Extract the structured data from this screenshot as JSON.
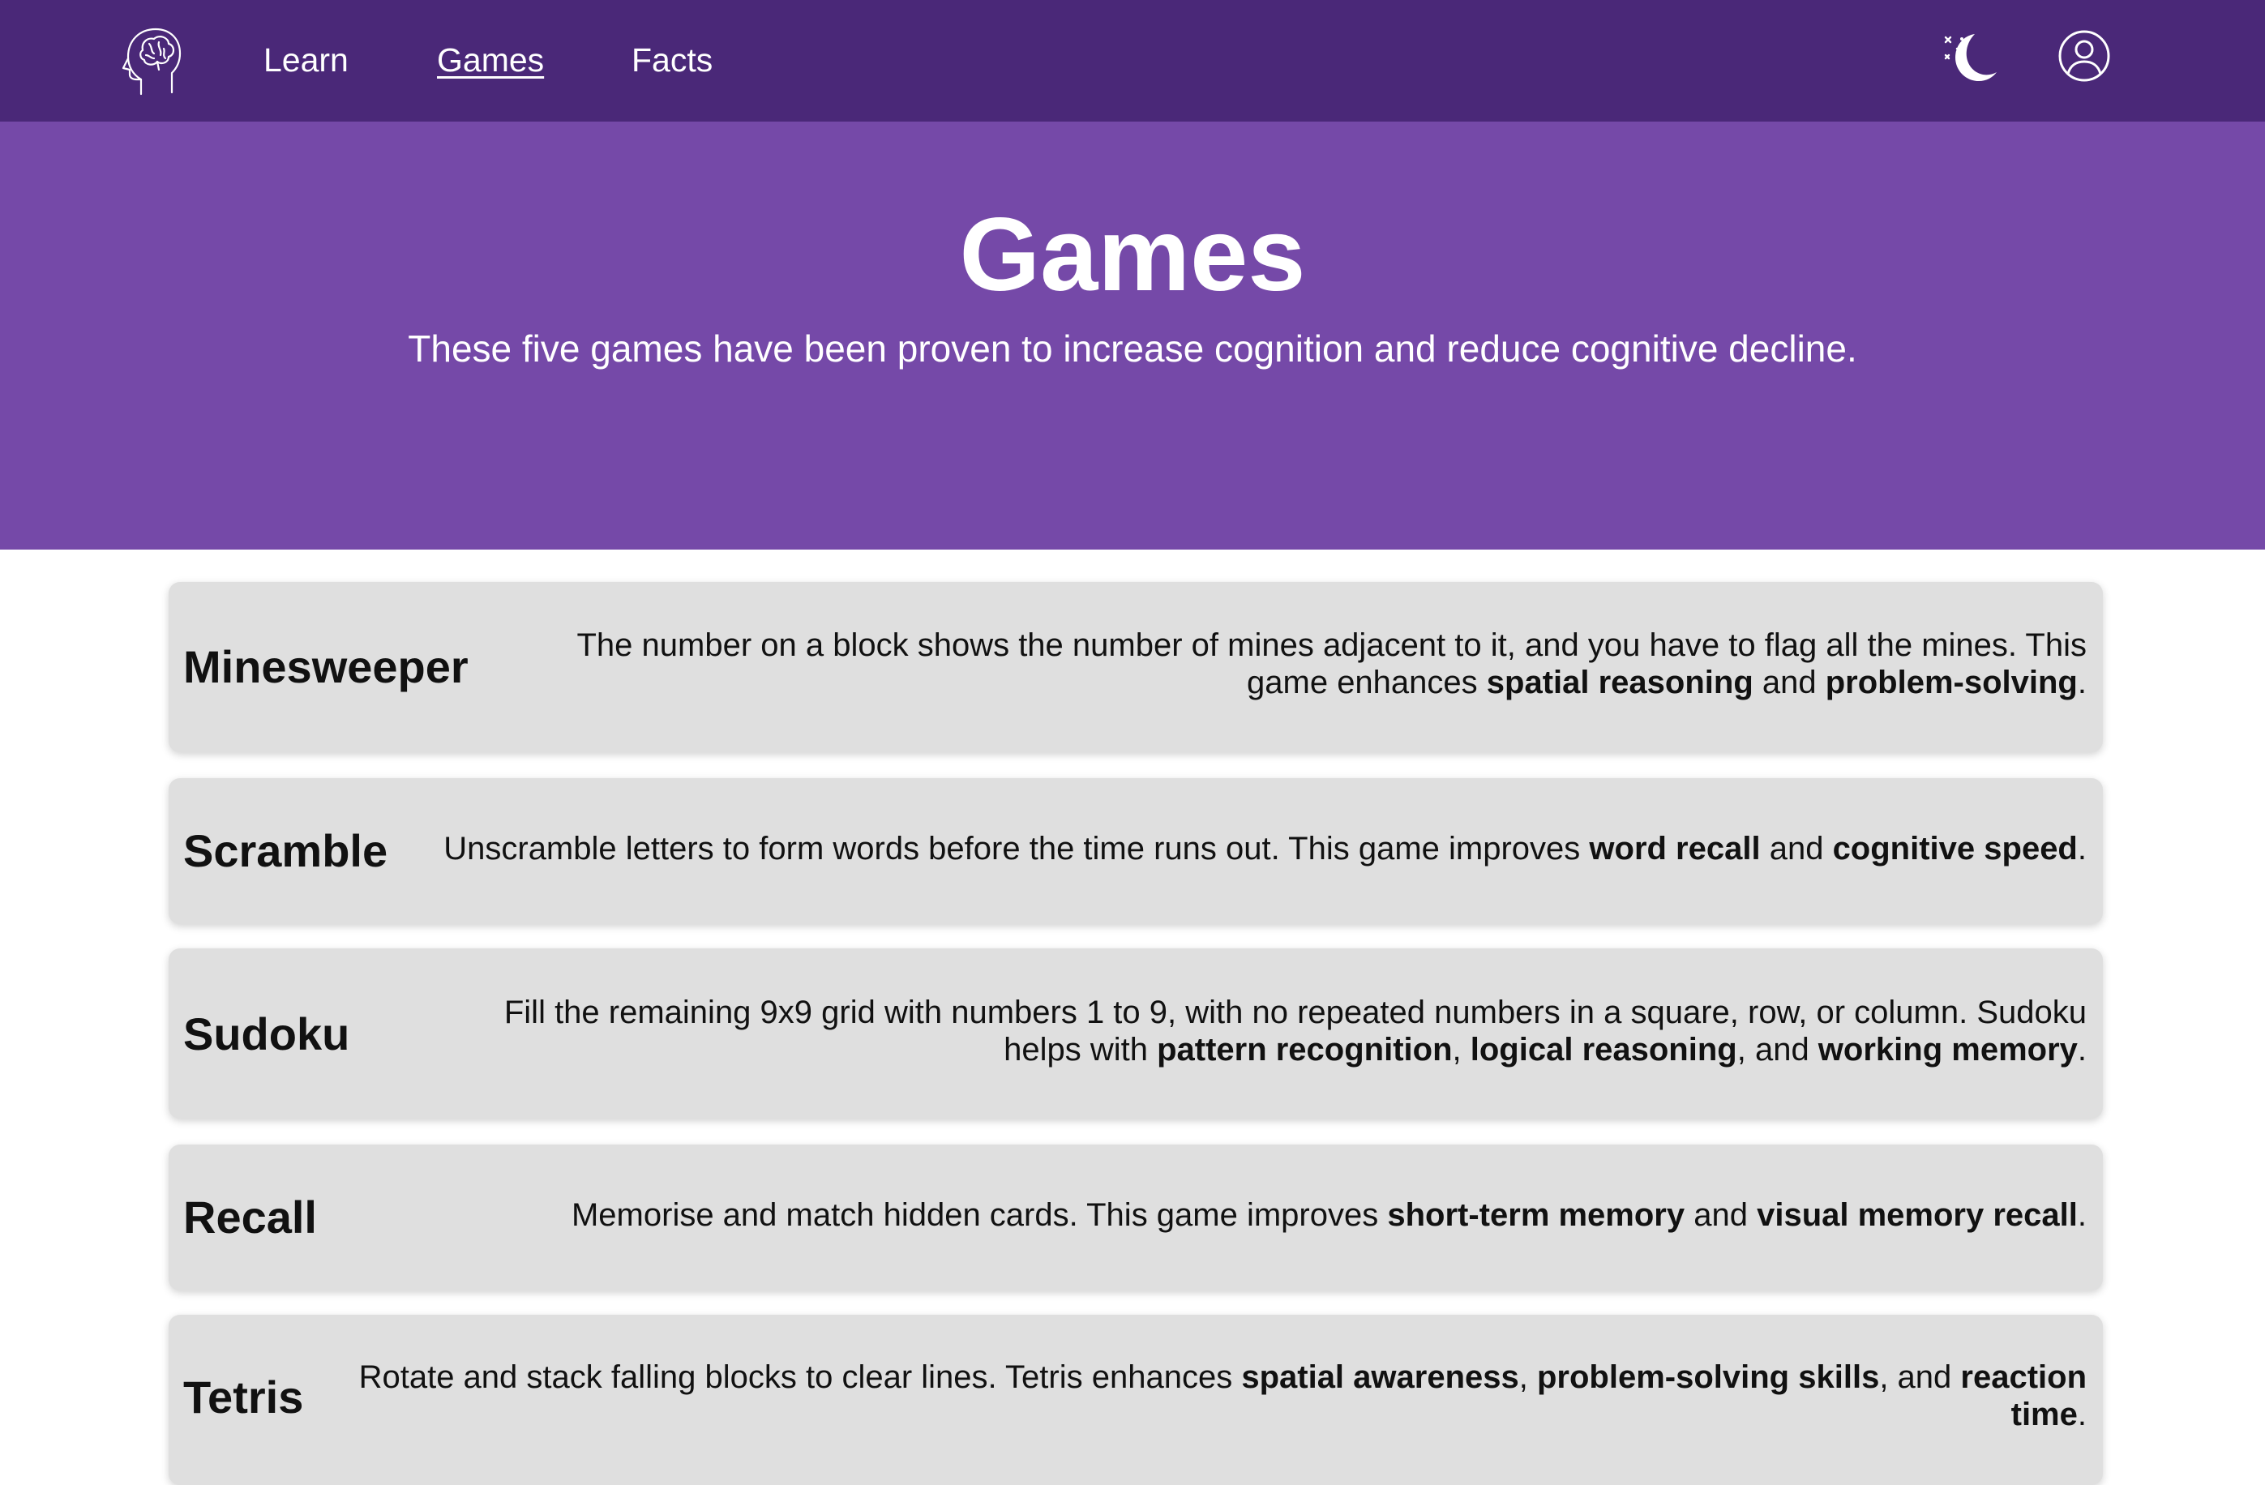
{
  "nav": {
    "logo_icon": "brain-head-icon",
    "links": [
      {
        "label": "Learn",
        "active": false
      },
      {
        "label": "Games",
        "active": true
      },
      {
        "label": "Facts",
        "active": false
      }
    ],
    "theme_icon": "moon-icon",
    "profile_icon": "user-profile-icon"
  },
  "hero": {
    "title": "Games",
    "subtitle": "These five games have been proven to increase cognition and reduce cognitive decline."
  },
  "games": [
    {
      "name": "Minesweeper",
      "desc_parts": [
        {
          "text": "The number on a block shows the number of mines adjacent to it, and you have to flag all the mines. This game enhances ",
          "bold": false
        },
        {
          "text": "spatial reasoning",
          "bold": true
        },
        {
          "text": " and ",
          "bold": false
        },
        {
          "text": "problem-solving",
          "bold": true
        },
        {
          "text": ".",
          "bold": false
        }
      ]
    },
    {
      "name": "Scramble",
      "desc_parts": [
        {
          "text": "Unscramble letters to form words before the time runs out. This game improves ",
          "bold": false
        },
        {
          "text": "word recall",
          "bold": true
        },
        {
          "text": " and ",
          "bold": false
        },
        {
          "text": "cognitive speed",
          "bold": true
        },
        {
          "text": ".",
          "bold": false
        }
      ]
    },
    {
      "name": "Sudoku",
      "desc_parts": [
        {
          "text": "Fill the remaining 9x9 grid with numbers 1 to 9, with no repeated numbers in a square, row, or column. Sudoku helps with ",
          "bold": false
        },
        {
          "text": "pattern recognition",
          "bold": true
        },
        {
          "text": ", ",
          "bold": false
        },
        {
          "text": "logical reasoning",
          "bold": true
        },
        {
          "text": ", and ",
          "bold": false
        },
        {
          "text": "working memory",
          "bold": true
        },
        {
          "text": ".",
          "bold": false
        }
      ]
    },
    {
      "name": "Recall",
      "desc_parts": [
        {
          "text": "Memorise and match hidden cards. This game improves ",
          "bold": false
        },
        {
          "text": "short-term memory",
          "bold": true
        },
        {
          "text": " and ",
          "bold": false
        },
        {
          "text": "visual memory recall",
          "bold": true
        },
        {
          "text": ".",
          "bold": false
        }
      ]
    },
    {
      "name": "Tetris",
      "desc_parts": [
        {
          "text": "Rotate and stack falling blocks to clear lines. Tetris enhances ",
          "bold": false
        },
        {
          "text": "spatial awareness",
          "bold": true
        },
        {
          "text": ", ",
          "bold": false
        },
        {
          "text": "problem-solving skills",
          "bold": true
        },
        {
          "text": ", and ",
          "bold": false
        },
        {
          "text": "reaction time",
          "bold": true
        },
        {
          "text": ".",
          "bold": false
        }
      ]
    }
  ],
  "colors": {
    "nav_bg": "#4a2878",
    "hero_bg": "#7549a8",
    "card_bg": "#dfdfdf"
  }
}
